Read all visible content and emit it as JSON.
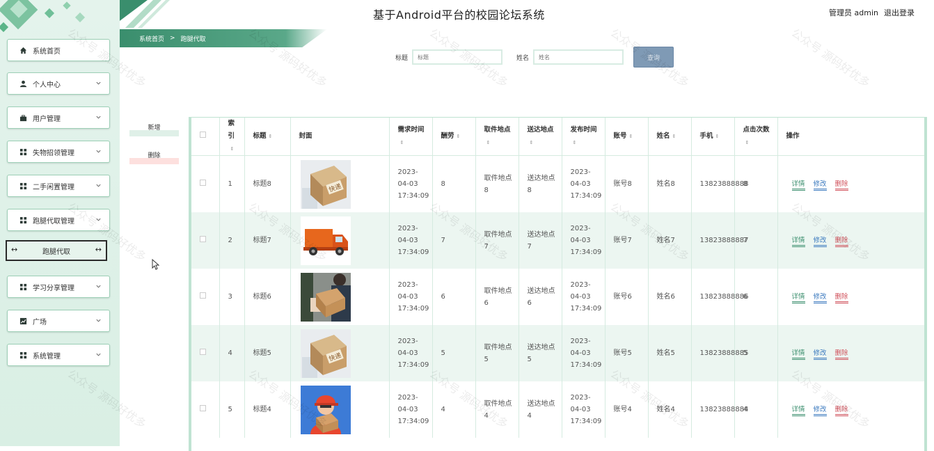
{
  "header": {
    "title": "基于Android平台的校园论坛系统",
    "user_label": "管理员 admin",
    "logout_label": "退出登录"
  },
  "breadcrumb": {
    "home": "系统首页",
    "sep": ">",
    "current": "跑腿代取"
  },
  "sidebar": {
    "items": [
      {
        "label": "系统首页",
        "icon": "home-icon"
      },
      {
        "label": "个人中心",
        "icon": "user-icon"
      },
      {
        "label": "用户管理",
        "icon": "briefcase-icon"
      },
      {
        "label": "失物招领管理",
        "icon": "grid-icon"
      },
      {
        "label": "二手闲置管理",
        "icon": "grid-icon"
      },
      {
        "label": "跑腿代取管理",
        "icon": "grid-icon"
      },
      {
        "label": "学习分享管理",
        "icon": "grid-icon"
      },
      {
        "label": "广场",
        "icon": "chart-icon"
      },
      {
        "label": "系统管理",
        "icon": "grid-icon"
      }
    ],
    "sub_item": "跑腿代取"
  },
  "search": {
    "title_label": "标题",
    "title_placeholder": "标题",
    "name_label": "姓名",
    "name_placeholder": "姓名",
    "query_button": "查询"
  },
  "actions": {
    "add": "新增",
    "delete": "删除"
  },
  "table": {
    "headers": [
      "索引",
      "标题",
      "封面",
      "需求时间",
      "酬劳",
      "取件地点",
      "送达地点",
      "发布时间",
      "账号",
      "姓名",
      "手机",
      "点击次数",
      "操作"
    ],
    "ops": {
      "detail": "详情",
      "edit": "修改",
      "delete": "删除"
    },
    "rows": [
      {
        "index": "1",
        "title": "标题8",
        "cover": "package-box-image",
        "need_time": "2023-04-03 17:34:09",
        "reward": "8",
        "pickup": "取件地点8",
        "deliver": "送达地点8",
        "publish_time": "2023-04-03 17:34:09",
        "account": "账号8",
        "name": "姓名8",
        "phone": "13823888888",
        "clicks": "8"
      },
      {
        "index": "2",
        "title": "标题7",
        "cover": "delivery-truck-image",
        "need_time": "2023-04-03 17:34:09",
        "reward": "7",
        "pickup": "取件地点7",
        "deliver": "送达地点7",
        "publish_time": "2023-04-03 17:34:09",
        "account": "账号7",
        "name": "姓名7",
        "phone": "13823888887",
        "clicks": "7"
      },
      {
        "index": "3",
        "title": "标题6",
        "cover": "courier-handover-image",
        "need_time": "2023-04-03 17:34:09",
        "reward": "6",
        "pickup": "取件地点6",
        "deliver": "送达地点6",
        "publish_time": "2023-04-03 17:34:09",
        "account": "账号6",
        "name": "姓名6",
        "phone": "13823888886",
        "clicks": "6"
      },
      {
        "index": "4",
        "title": "标题5",
        "cover": "package-box-image",
        "need_time": "2023-04-03 17:34:09",
        "reward": "5",
        "pickup": "取件地点5",
        "deliver": "送达地点5",
        "publish_time": "2023-04-03 17:34:09",
        "account": "账号5",
        "name": "姓名5",
        "phone": "13823888885",
        "clicks": "5"
      },
      {
        "index": "5",
        "title": "标题4",
        "cover": "courier-avatar-image",
        "need_time": "2023-04-03 17:34:09",
        "reward": "4",
        "pickup": "取件地点4",
        "deliver": "送达地点4",
        "publish_time": "2023-04-03 17:34:09",
        "account": "账号4",
        "name": "姓名4",
        "phone": "13823888884",
        "clicks": "4"
      }
    ]
  },
  "watermark": "公众号 源码好优多",
  "colors": {
    "accent": "#3a8e6d",
    "sidebar_bg": "#e4f3ec",
    "row_alt": "#ecf6f1",
    "edit": "#3d7bbf",
    "danger": "#d0505a"
  }
}
